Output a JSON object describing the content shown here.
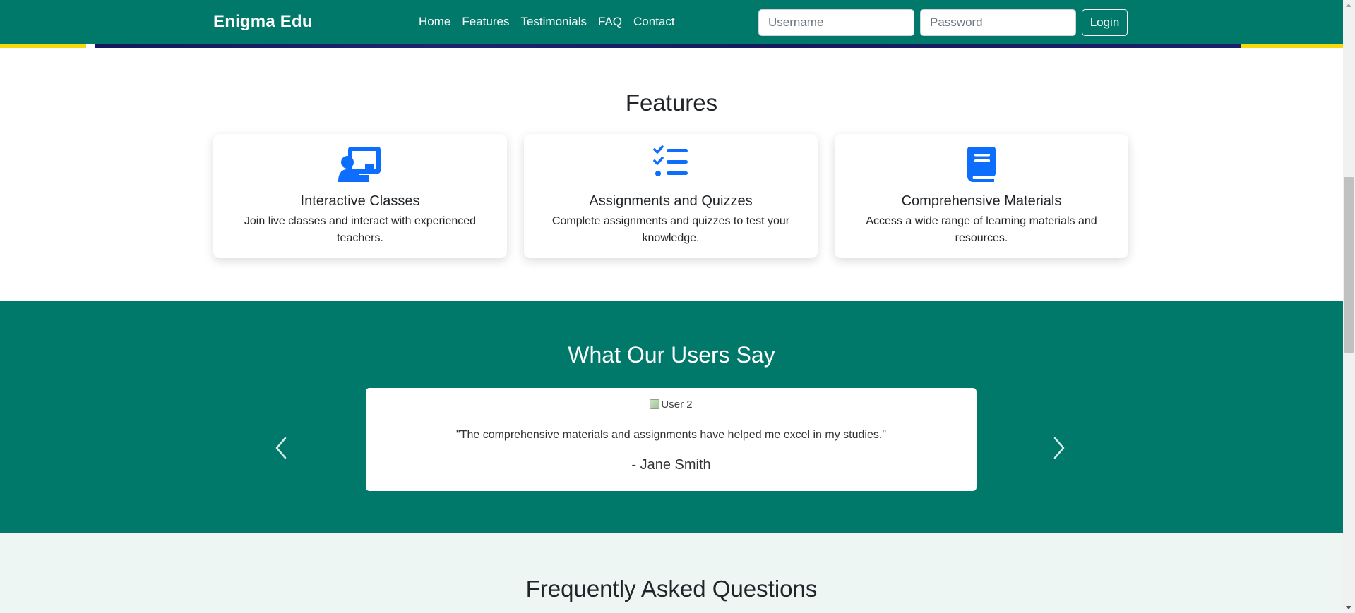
{
  "nav": {
    "brand": "Enigma Edu",
    "links": [
      "Home",
      "Features",
      "Testimonials",
      "FAQ",
      "Contact"
    ],
    "username_placeholder": "Username",
    "password_placeholder": "Password",
    "login_label": "Login",
    "color": "#00796b"
  },
  "features": {
    "title": "Features",
    "cards": [
      {
        "icon": "chalkboard-teacher-icon",
        "title": "Interactive Classes",
        "text": "Join live classes and interact with experienced teachers."
      },
      {
        "icon": "tasks-list-icon",
        "title": "Assignments and Quizzes",
        "text": "Complete assignments and quizzes to test your knowledge."
      },
      {
        "icon": "book-icon",
        "title": "Comprehensive Materials",
        "text": "Access a wide range of learning materials and resources."
      }
    ],
    "icon_color": "#0d6efd"
  },
  "testimonials": {
    "title": "What Our Users Say",
    "image_alt": "User 2",
    "quote": "\"The comprehensive materials and assignments have helped me excel in my studies.\"",
    "author": "- Jane Smith"
  },
  "faq": {
    "title": "Frequently Asked Questions"
  }
}
